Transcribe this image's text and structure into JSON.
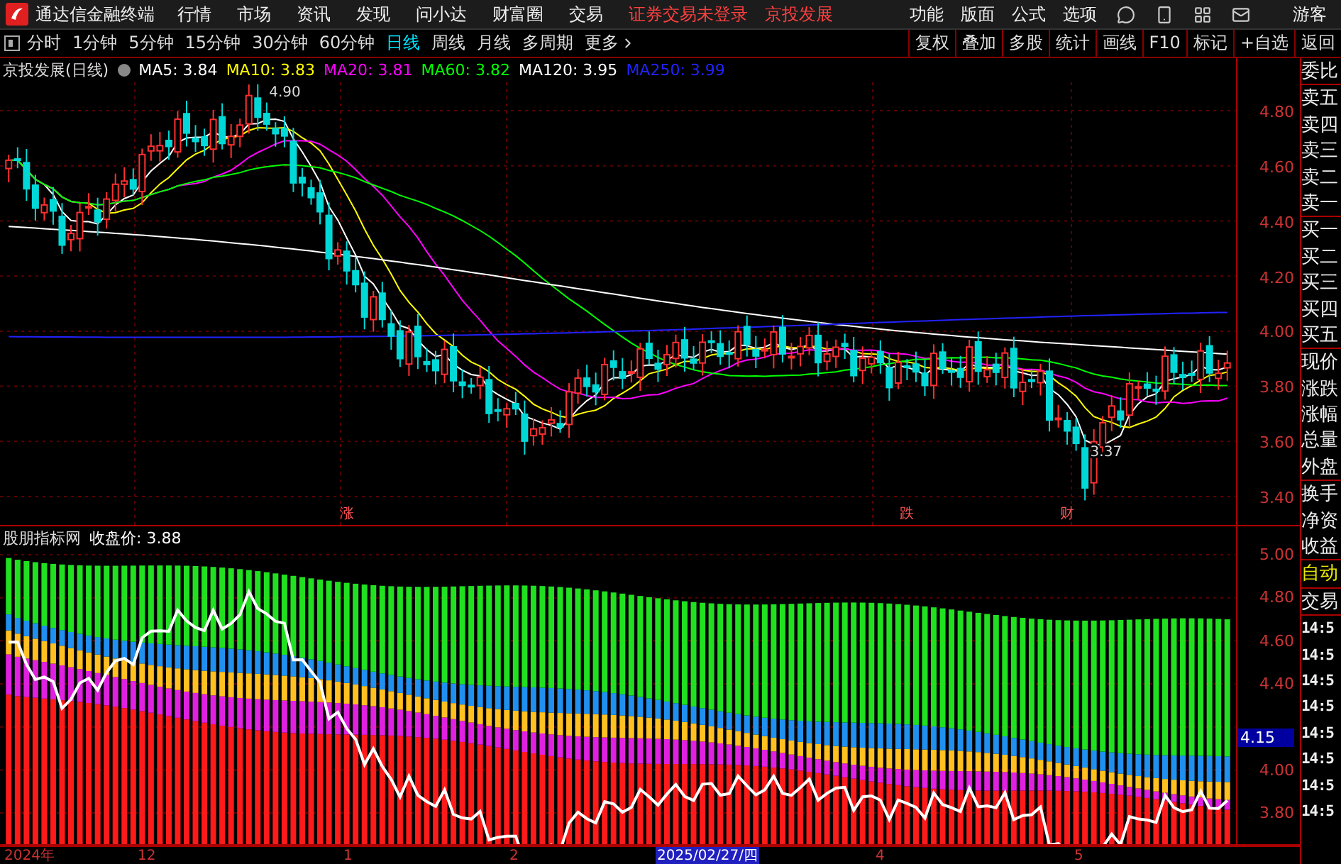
{
  "title_bar": {
    "app_name": "通达信金融终端",
    "menu": [
      "行情",
      "市场",
      "资讯",
      "发现",
      "问小达",
      "财富圈",
      "交易"
    ],
    "notices": [
      "证券交易未登录",
      "京投发展"
    ],
    "tools": [
      "功能",
      "版面",
      "公式",
      "选项"
    ],
    "user": "游客"
  },
  "toolbar": {
    "periods": [
      {
        "label": "分时",
        "selected": false
      },
      {
        "label": "1分钟",
        "selected": false
      },
      {
        "label": "5分钟",
        "selected": false
      },
      {
        "label": "15分钟",
        "selected": false
      },
      {
        "label": "30分钟",
        "selected": false
      },
      {
        "label": "60分钟",
        "selected": false
      },
      {
        "label": "日线",
        "selected": true
      },
      {
        "label": "周线",
        "selected": false
      },
      {
        "label": "月线",
        "selected": false
      },
      {
        "label": "多周期",
        "selected": false
      },
      {
        "label": "更多",
        "selected": false
      }
    ],
    "actions": [
      "复权",
      "叠加",
      "多股",
      "统计",
      "画线",
      "F10",
      "标记",
      "+自选",
      "返回"
    ]
  },
  "chart": {
    "title": "京投发展(日线)",
    "ma": [
      {
        "label": "MA5: 3.84",
        "color": "#ffffff"
      },
      {
        "label": "MA10: 3.83",
        "color": "#ffff00"
      },
      {
        "label": "MA20: 3.81",
        "color": "#ff00ff"
      },
      {
        "label": "MA60: 3.82",
        "color": "#00ff00"
      },
      {
        "label": "MA120: 3.95",
        "color": "#ffffff"
      },
      {
        "label": "MA250: 3.99",
        "color": "#2222ff"
      }
    ],
    "high_label": "4.90",
    "low_label": "3.37",
    "event_marks": [
      "涨",
      "跌",
      "财"
    ],
    "price_axis": [
      "4.80",
      "4.60",
      "4.40",
      "4.20",
      "4.00",
      "3.80",
      "3.60",
      "3.40"
    ]
  },
  "indicator": {
    "name": "股朋指标网",
    "value": "收盘价: 3.88",
    "axis": [
      {
        "label": "5.00",
        "selected": false
      },
      {
        "label": "4.80",
        "selected": false
      },
      {
        "label": "4.60",
        "selected": false
      },
      {
        "label": "4.40",
        "selected": false
      },
      {
        "label": "4.15",
        "selected": true
      },
      {
        "label": "4.00",
        "selected": false
      },
      {
        "label": "3.80",
        "selected": false
      }
    ]
  },
  "date_axis": [
    {
      "label": "2024年",
      "selected": false
    },
    {
      "label": "12",
      "selected": false
    },
    {
      "label": "1",
      "selected": false
    },
    {
      "label": "2",
      "selected": false
    },
    {
      "label": "2025/02/27/四",
      "selected": true
    },
    {
      "label": "4",
      "selected": false
    },
    {
      "label": "5",
      "selected": false
    }
  ],
  "quote_panel": [
    {
      "label": "委比",
      "kind": "field",
      "divider_after": true
    },
    {
      "label": "卖五",
      "kind": "field",
      "divider_after": false
    },
    {
      "label": "卖四",
      "kind": "field",
      "divider_after": false
    },
    {
      "label": "卖三",
      "kind": "field",
      "divider_after": false
    },
    {
      "label": "卖二",
      "kind": "field",
      "divider_after": false
    },
    {
      "label": "卖一",
      "kind": "field",
      "divider_after": true
    },
    {
      "label": "买一",
      "kind": "field",
      "divider_after": false
    },
    {
      "label": "买二",
      "kind": "field",
      "divider_after": false
    },
    {
      "label": "买三",
      "kind": "field",
      "divider_after": false
    },
    {
      "label": "买四",
      "kind": "field",
      "divider_after": false
    },
    {
      "label": "买五",
      "kind": "field",
      "divider_after": true
    },
    {
      "label": "现价",
      "kind": "field",
      "divider_after": false
    },
    {
      "label": "涨跌",
      "kind": "field",
      "divider_after": false
    },
    {
      "label": "涨幅",
      "kind": "field",
      "divider_after": false
    },
    {
      "label": "总量",
      "kind": "field",
      "divider_after": false
    },
    {
      "label": "外盘",
      "kind": "field",
      "divider_after": true
    },
    {
      "label": "换手",
      "kind": "field",
      "divider_after": false
    },
    {
      "label": "净资",
      "kind": "field",
      "divider_after": false
    },
    {
      "label": "收益",
      "kind": "field",
      "divider_after": true
    },
    {
      "label": "自动",
      "kind": "mode",
      "divider_after": true
    },
    {
      "label": "交易",
      "kind": "field",
      "divider_after": true
    },
    {
      "label": "14:5",
      "kind": "time",
      "divider_after": false
    },
    {
      "label": "14:5",
      "kind": "time",
      "divider_after": false
    },
    {
      "label": "14:5",
      "kind": "time",
      "divider_after": false
    },
    {
      "label": "14:5",
      "kind": "time",
      "divider_after": false
    },
    {
      "label": "14:5",
      "kind": "time",
      "divider_after": false
    },
    {
      "label": "14:5",
      "kind": "time",
      "divider_after": false
    },
    {
      "label": "14:5",
      "kind": "time",
      "divider_after": false
    },
    {
      "label": "14:5",
      "kind": "time",
      "divider_after": false
    }
  ]
}
